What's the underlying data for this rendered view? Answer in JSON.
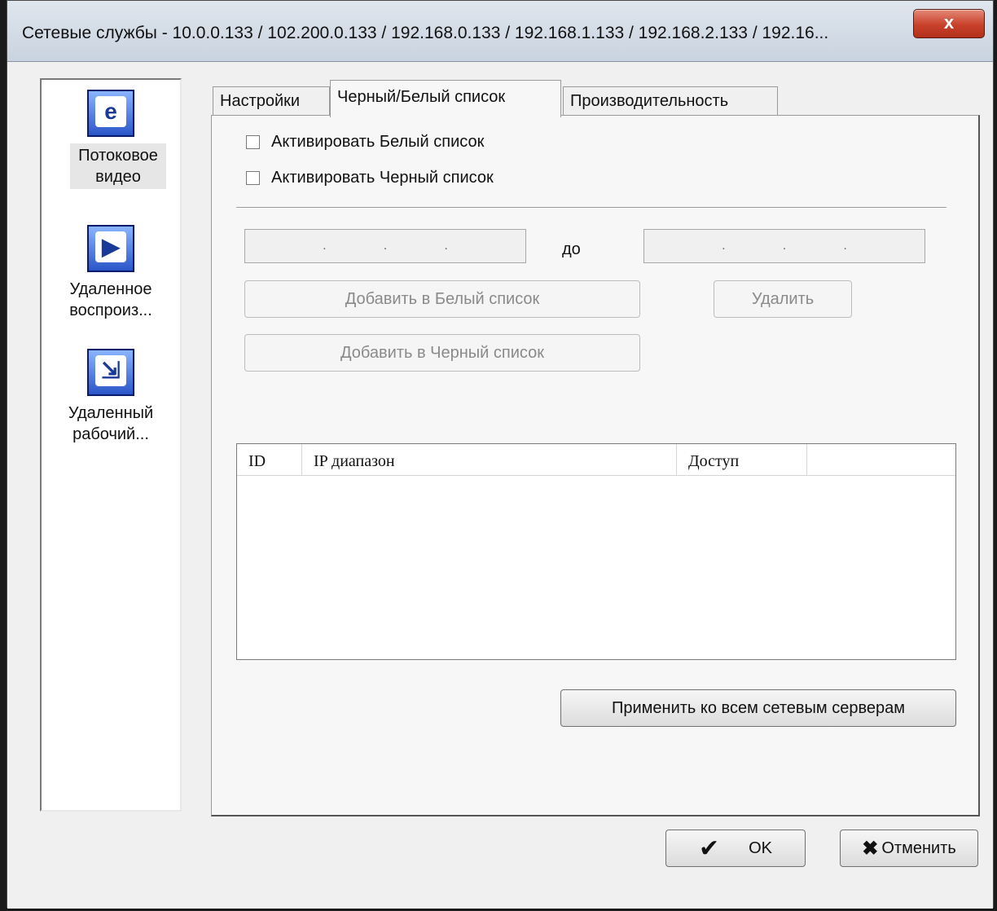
{
  "window": {
    "title": "Сетевые службы - 10.0.0.133 / 102.200.0.133 / 192.168.0.133 / 192.168.1.133 / 192.168.2.133 / 192.16...",
    "close_label": "x"
  },
  "sidebar": {
    "items": [
      {
        "label": "Потоковое видео",
        "icon": "streaming-video-icon",
        "glyph": "e"
      },
      {
        "label": "Удаленное воспроиз...",
        "icon": "remote-playback-icon",
        "glyph": "▶"
      },
      {
        "label": "Удаленный рабочий...",
        "icon": "remote-desktop-icon",
        "glyph": "⇲"
      }
    ]
  },
  "tabs": [
    "Настройки",
    "Черный/Белый список",
    "Производительность"
  ],
  "active_tab": "Черный/Белый список",
  "panel": {
    "whitelist_checkbox": "Активировать Белый список",
    "blacklist_checkbox": "Активировать Черный список",
    "to_label": "до",
    "add_whitelist": "Добавить в Белый список",
    "add_blacklist": "Добавить в Черный список",
    "delete": "Удалить",
    "columns": [
      "ID",
      "IP диапазон",
      "Доступ"
    ],
    "apply_all": "Применить ко всем сетевым серверам"
  },
  "footer": {
    "ok": "OK",
    "cancel": "Отменить"
  }
}
